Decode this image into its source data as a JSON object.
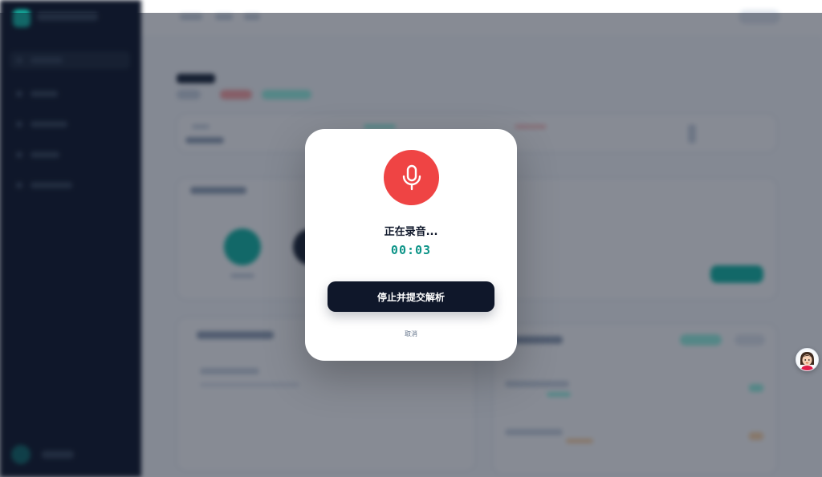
{
  "modal": {
    "title": "正在录音...",
    "timer": "00:03",
    "stop_label": "停止并提交解析",
    "cancel_label": "取消",
    "icon": "microphone-icon"
  },
  "floating": {
    "icon": "assistant-avatar-icon"
  },
  "colors": {
    "record_red": "#ef4444",
    "timer_teal": "#0d9488",
    "button_dark": "#0f172a",
    "sidebar_bg": "#0f172a",
    "overlay": "rgba(15,23,42,0.5)"
  }
}
